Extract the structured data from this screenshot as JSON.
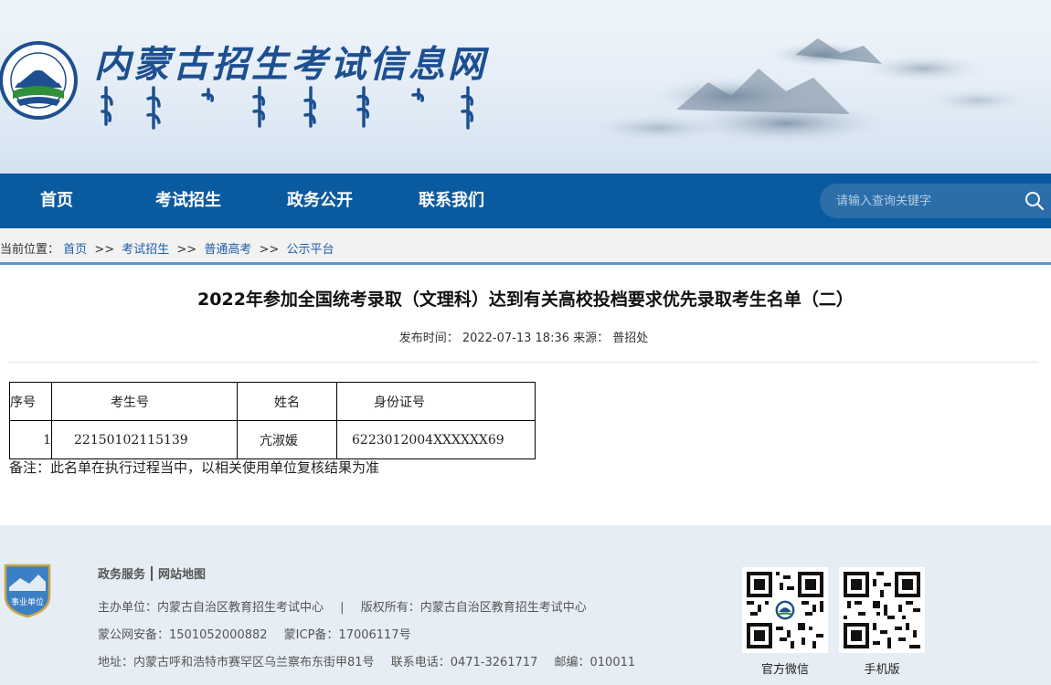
{
  "header": {
    "site_title": "内蒙古招生考试信息网"
  },
  "nav": {
    "items": [
      {
        "label": "首页"
      },
      {
        "label": "考试招生"
      },
      {
        "label": "政务公开"
      },
      {
        "label": "联系我们"
      }
    ],
    "search_placeholder": "请输入查询关键字"
  },
  "breadcrumb": {
    "prefix": "当前位置：",
    "items": [
      "首页",
      "考试招生",
      "普通高考",
      "公示平台"
    ],
    "separator": ">>"
  },
  "article": {
    "title": "2022年参加全国统考录取（文理科）达到有关高校投档要求优先录取考生名单（二）",
    "publish_label": "发布时间：",
    "publish_time": "2022-07-13 18:36",
    "source_label": "来源：",
    "source": "普招处"
  },
  "table": {
    "headers": [
      "序号",
      "考生号",
      "姓名",
      "身份证号"
    ],
    "rows": [
      [
        "1",
        "22150102115139",
        "亢淑媛",
        "6223012004XXXXXX69"
      ]
    ]
  },
  "note": "备注：此名单在执行过程当中，以相关使用单位复核结果为准",
  "footer": {
    "badge_text": "事业单位",
    "links": [
      "政务服务",
      "网站地图"
    ],
    "sponsor": "主办单位：内蒙古自治区教育招生考试中心",
    "copyright": "版权所有：内蒙古自治区教育招生考试中心",
    "pipe": "|",
    "police_record": "蒙公网安备：1501052000882",
    "icp_record": "蒙ICP备：17006117号",
    "address": "地址：内蒙古呼和浩特市赛罕区乌兰察布东街甲81号",
    "phone": "联系电话：0471-3261717",
    "postcode": "邮编：010011",
    "qr_wechat_label": "官方微信",
    "qr_mobile_label": "手机版"
  }
}
